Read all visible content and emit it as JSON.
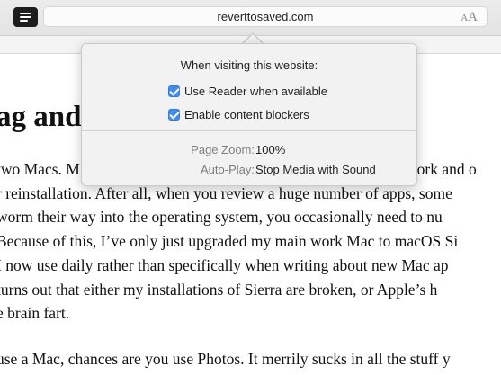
{
  "toolbar": {
    "address": "reverttosaved.com",
    "text_size_small": "A",
    "text_size_large": "A"
  },
  "article": {
    "heading": "ag and",
    "para1_lines": [
      "two Macs. M",
      "r reinstallation. After all, when you review a huge number of apps, some",
      "worm their way into the operating system, you occasionally need to nu",
      "Because of this, I’ve only just upgraded my main work Mac to macOS Si",
      "I now use daily rather than specifically when writing about new Mac ap",
      "turns out that either my installations of Sierra are broken, or Apple’s h",
      "e brain fart."
    ],
    "para1_line1_tail": "work and o",
    "para2_line": "use a Mac, chances are you use Photos. It merrily sucks in all the stuff y"
  },
  "popover": {
    "title": "When visiting this website:",
    "options": [
      {
        "label": "Use Reader when available",
        "checked": true
      },
      {
        "label": "Enable content blockers",
        "checked": true
      }
    ],
    "settings": [
      {
        "label": "Page Zoom:",
        "value": "100%"
      },
      {
        "label": "Auto-Play:",
        "value": "Stop Media with Sound"
      }
    ]
  },
  "colors": {
    "checkbox": "#3d8df5",
    "popover_bg": "#f2f2f2",
    "toolbar_bg": "#e6e6e6"
  }
}
